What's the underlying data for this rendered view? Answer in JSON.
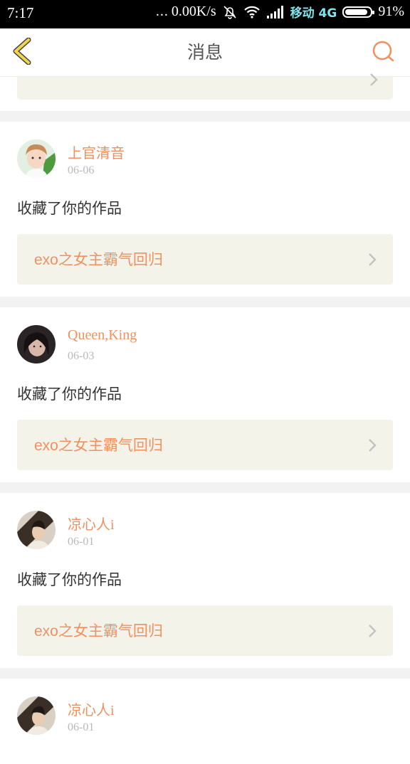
{
  "status_bar": {
    "time": "7:17",
    "dots": "...",
    "speed": "0.00K/s",
    "carrier": "移动 4G",
    "battery": "91%",
    "icons": [
      "bell-off-icon",
      "wifi-icon",
      "signal-icon",
      "battery-icon"
    ]
  },
  "header": {
    "title": "消息",
    "back_icon": "chevron-left-icon",
    "search_icon": "search-icon"
  },
  "colors": {
    "accent": "#f0905e",
    "back_yellow": "#f1d64a",
    "card_box": "#f4f3ea"
  },
  "messages": [
    {
      "user": "上官清音",
      "date": "06-06",
      "action": "收藏了你的作品",
      "work": "exo之女主霸气回归",
      "avatar": "avatar-1"
    },
    {
      "user": "Queen,King",
      "date": "06-03",
      "action": "收藏了你的作品",
      "work": "exo之女主霸气回归",
      "avatar": "avatar-2"
    },
    {
      "user": "凉心人i",
      "date": "06-01",
      "action": "收藏了你的作品",
      "work": "exo之女主霸气回归",
      "avatar": "avatar-3"
    },
    {
      "user": "凉心人i",
      "date": "06-01",
      "avatar": "avatar-3"
    }
  ]
}
